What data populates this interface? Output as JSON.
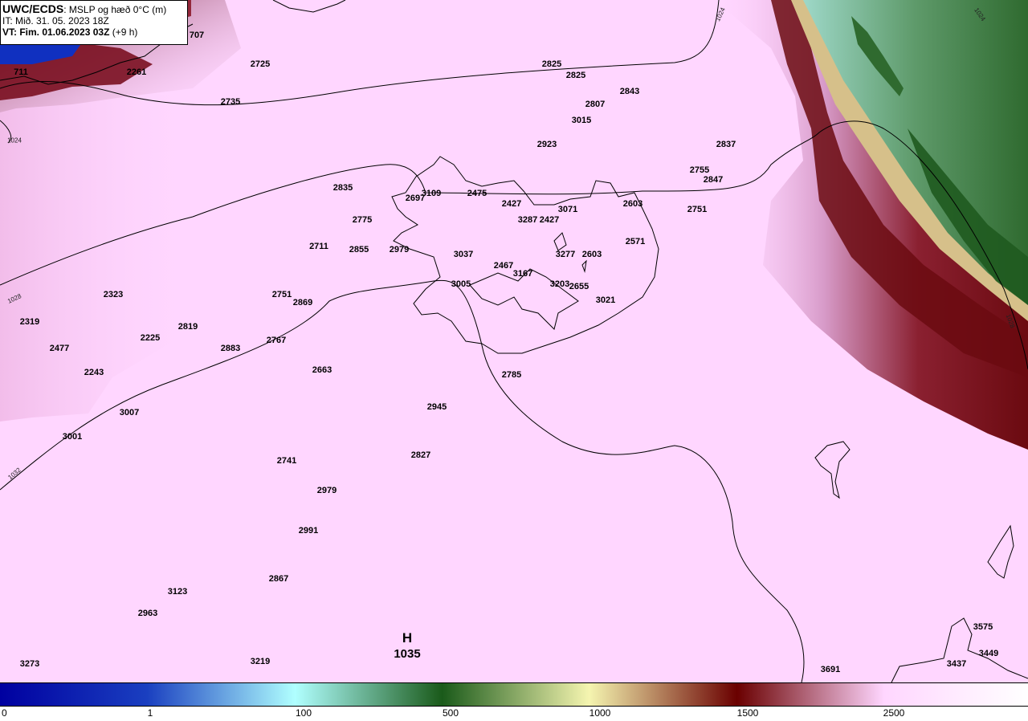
{
  "header": {
    "brand": "UWC/ECDS",
    "title": ": MSLP og hæð 0°C (m)",
    "issue_time": "IT: Mið. 31. 05. 2023 18Z",
    "valid_prefix": "VT: Fim. 01.06.2023 03Z",
    "valid_suffix": " (+9 h)"
  },
  "colors": {
    "background": "#ffd6ff",
    "isobar": "#000000",
    "land_outline": "#000000",
    "high_freezing": "#6b0a10",
    "green_band": "#3f7a3a",
    "blue_band": "#1030c0"
  },
  "pressure_center": {
    "letter": "H",
    "value": "1035"
  },
  "isobar_labels": [
    "1024",
    "1024",
    "1024",
    "1028",
    "1032",
    "1028"
  ],
  "stations": [
    "2725",
    "2261",
    "2735",
    "2825",
    "2825",
    "2843",
    "2807",
    "3015",
    "2923",
    "2837",
    "2755",
    "2847",
    "2751",
    "2835",
    "2697",
    "3109",
    "2475",
    "2427",
    "3287",
    "2427",
    "3071",
    "2603",
    "2775",
    "2711",
    "2855",
    "2979",
    "3037",
    "2571",
    "2467",
    "3167",
    "3277",
    "2603",
    "3005",
    "3203",
    "2655",
    "3021",
    "2323",
    "2751",
    "2869",
    "2319",
    "2225",
    "2819",
    "2477",
    "2883",
    "2767",
    "2243",
    "2663",
    "2785",
    "2945",
    "3007",
    "3001",
    "2827",
    "2741",
    "2979",
    "2991",
    "2867",
    "3123",
    "2963",
    "3219",
    "3273",
    "3575",
    "3449",
    "3437",
    "3691",
    "707",
    "711"
  ],
  "colorbar": {
    "labels": [
      "0",
      "1",
      "100",
      "500",
      "1000",
      "1500",
      "2500"
    ],
    "stops": [
      "#0000a0",
      "#1a3fc0",
      "#b0ffff",
      "#1a5a1a",
      "#f5f5b0",
      "#6a0000",
      "#ffd6ff"
    ]
  }
}
